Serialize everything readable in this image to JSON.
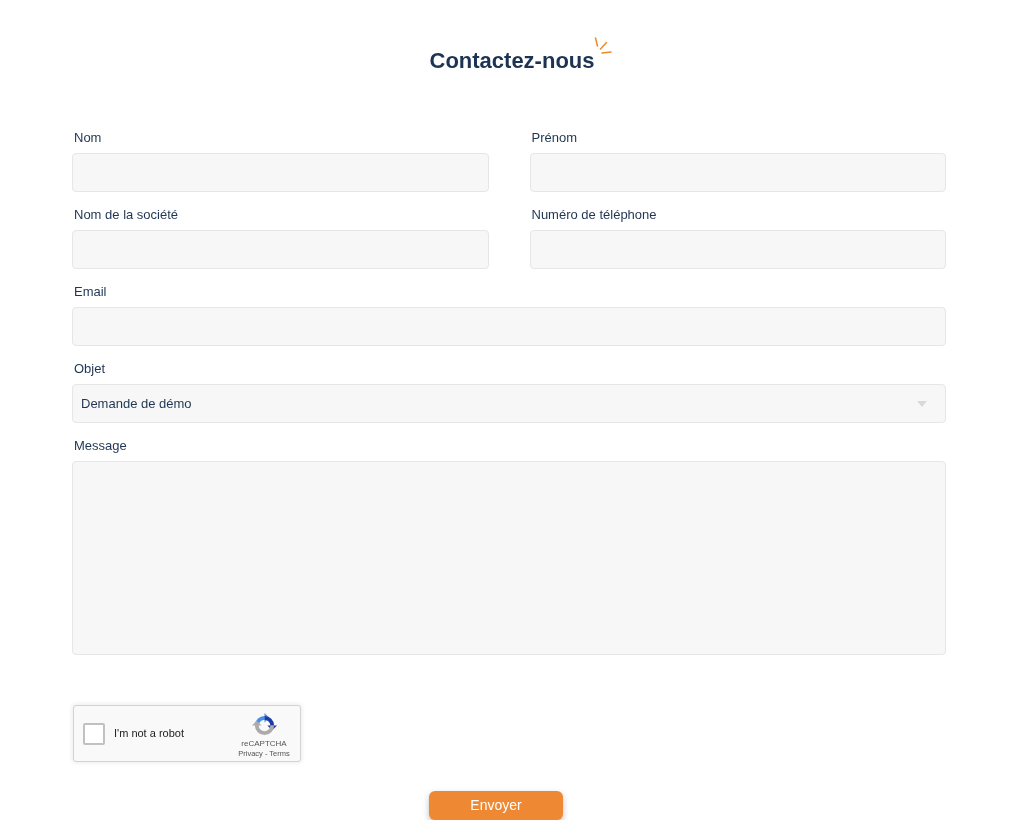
{
  "title": {
    "text": "Contactez-nous"
  },
  "form": {
    "rows": [
      [
        {
          "kind": "text",
          "label": "Nom"
        },
        {
          "kind": "text",
          "label": "Prénom"
        }
      ],
      [
        {
          "kind": "text",
          "label": "Nom de la société"
        },
        {
          "kind": "text",
          "label": "Numéro de téléphone"
        }
      ],
      [
        {
          "kind": "text",
          "label": "Email"
        }
      ],
      [
        {
          "kind": "select",
          "label": "Objet",
          "value": "Demande de démo"
        }
      ],
      [
        {
          "kind": "textarea",
          "label": "Message"
        }
      ]
    ]
  },
  "captcha": {
    "label": "I'm not a robot",
    "checked": false,
    "brand": "reCAPTCHA",
    "footer": "Privacy - Terms"
  },
  "submit": {
    "label": "Envoyer"
  }
}
